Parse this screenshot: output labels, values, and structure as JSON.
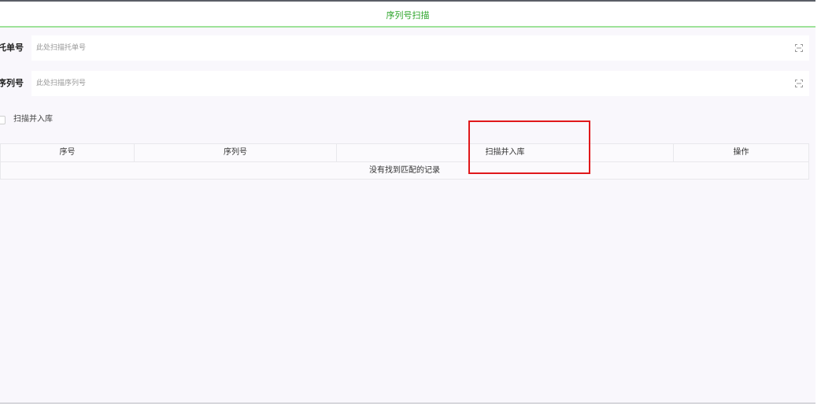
{
  "header": {
    "title": "序列号扫描"
  },
  "form": {
    "tracking": {
      "label": "托单号",
      "placeholder": "此处扫描托单号",
      "value": ""
    },
    "serial": {
      "label": "序列号",
      "placeholder": "此处扫描序列号",
      "value": ""
    }
  },
  "checkbox": {
    "label": "扫描并入库",
    "checked": false
  },
  "table": {
    "columns": [
      "序号",
      "序列号",
      "扫描并入库",
      "操作"
    ],
    "empty_message": "没有找到匹配的记录",
    "rows": []
  },
  "icons": {
    "scan": "scan-icon"
  },
  "colors": {
    "accent": "#2da42a",
    "accent_line": "#9ee29a",
    "highlight": "#e0181b"
  }
}
